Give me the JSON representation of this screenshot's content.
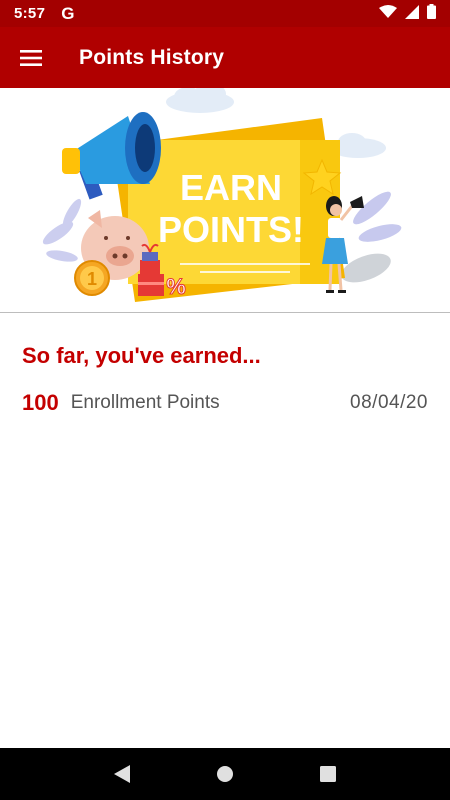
{
  "status_bar": {
    "time": "5:57",
    "g_label": "G",
    "icons": [
      "wifi-icon",
      "cell-signal-icon",
      "battery-icon"
    ]
  },
  "app_bar": {
    "title": "Points History",
    "menu_icon": "hamburger-menu-icon"
  },
  "banner": {
    "line1": "EARN",
    "line2": "POINTS!",
    "coin_text": "1",
    "percent_text": "%"
  },
  "content": {
    "heading": "So far, you've earned...",
    "entries": [
      {
        "points": "100",
        "description": "Enrollment Points",
        "date": "08/04/20"
      }
    ]
  },
  "nav_bar": {
    "buttons": [
      "back-icon",
      "home-icon",
      "recents-icon"
    ]
  },
  "colors": {
    "status_bar": "#a30000",
    "app_bar": "#b00000",
    "accent_red": "#c40000",
    "text_gray": "#555555",
    "banner_yellow": "#fdd835"
  }
}
